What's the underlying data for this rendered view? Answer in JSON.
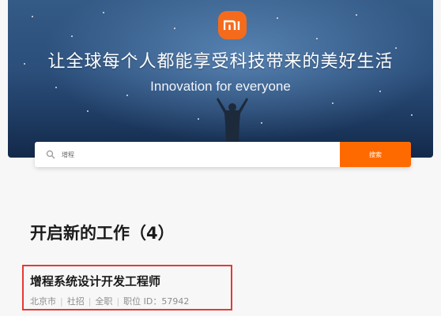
{
  "hero": {
    "logo_text": "mi",
    "slogan": "让全球每个人都能享受科技带来的美好生活",
    "tagline": "Innovation for everyone"
  },
  "search": {
    "value": "增程",
    "button_label": "搜索"
  },
  "section": {
    "title": "开启新的工作（4）"
  },
  "job": {
    "title": "增程系统设计开发工程师",
    "location": "北京市",
    "recruit_type": "社招",
    "work_type": "全职",
    "position_id": "职位 ID：57942"
  },
  "colors": {
    "brand": "#ff6a00",
    "highlight_border": "#e53935"
  },
  "icons": {
    "logo": "xiaomi-logo",
    "search": "search-icon"
  }
}
